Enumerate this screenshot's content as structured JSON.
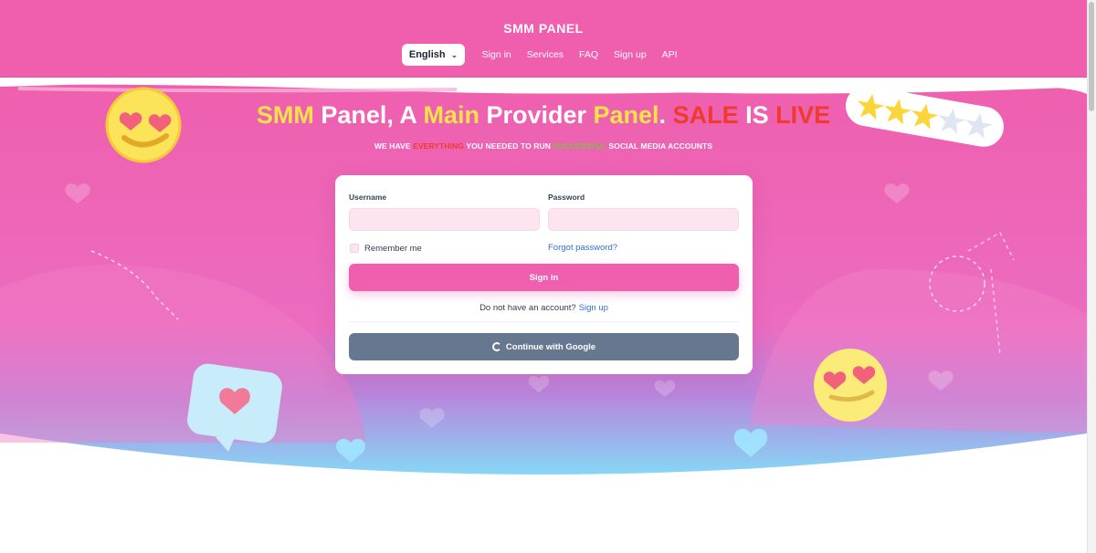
{
  "header": {
    "brand": "SMM PANEL",
    "language": "English",
    "nav": [
      "Sign in",
      "Services",
      "FAQ",
      "Sign up",
      "API"
    ]
  },
  "hero": {
    "headline": {
      "part1": "SMM",
      "part2": " Panel, A ",
      "part3": "Main",
      "part4": " Provider ",
      "part5": "Panel",
      "part6": ". ",
      "part7": "SALE",
      "part8": " IS ",
      "part9": "LIVE"
    },
    "sub": {
      "part1": "WE HAVE ",
      "part2": "EVERYTHING",
      "part3": " YOU NEEDED TO RUN ",
      "part4": "SUCCESSFUL",
      "part5": " SOCIAL MEDIA ACCOUNTS"
    }
  },
  "login": {
    "username_label": "Username",
    "username_value": "",
    "password_label": "Password",
    "password_value": "",
    "remember_label": "Remember me",
    "forgot_label": "Forgot password?",
    "signin_label": "Sign in",
    "no_account_text": "Do not have an account?",
    "signup_link": "Sign up",
    "google_label": "Continue with Google"
  },
  "colors": {
    "accent_pink": "#ef5fae",
    "yellow": "#f9e24a",
    "red": "#ee3b2b",
    "green": "#78c33b",
    "google_button": "#677790"
  }
}
